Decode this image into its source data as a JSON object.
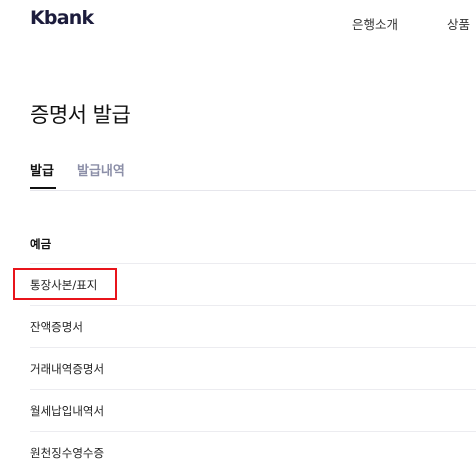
{
  "header": {
    "logo": "Kbank",
    "nav": [
      "은행소개",
      "상품"
    ]
  },
  "main": {
    "title": "증명서 발급",
    "tabs": [
      {
        "label": "발급",
        "active": true
      },
      {
        "label": "발급내역",
        "active": false
      }
    ],
    "section": {
      "title": "예금",
      "items": [
        {
          "label": "통장사본/표지",
          "highlighted": true
        },
        {
          "label": "잔액증명서"
        },
        {
          "label": "거래내역증명서"
        },
        {
          "label": "월세납입내역서"
        },
        {
          "label": "원천징수영수증"
        }
      ]
    }
  },
  "colors": {
    "highlight_border": "#e8141b",
    "inactive_tab": "#8c8fa8"
  }
}
